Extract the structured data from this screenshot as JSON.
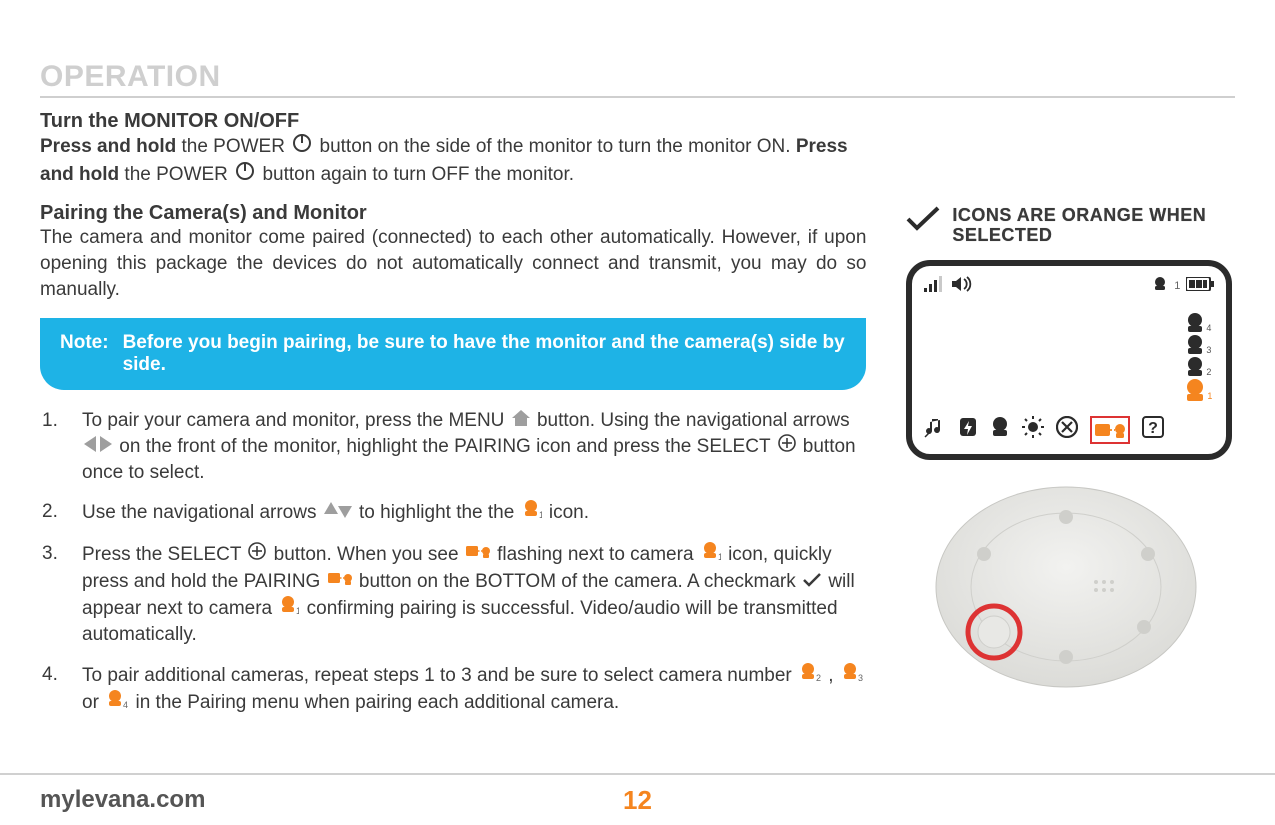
{
  "section_title": "OPERATION",
  "monitor_onoff": {
    "heading": "Turn the MONITOR ON/OFF",
    "part1a": "Press and hold",
    "part1b": " the POWER ",
    "part1c": " button on the side of the monitor to turn the monitor ON. ",
    "part2a": "Press and hold",
    "part2b": " the POWER ",
    "part2c": " button again to turn OFF the monitor."
  },
  "pairing": {
    "heading": "Pairing the Camera(s) and Monitor",
    "body": "The camera and monitor come paired (connected) to each other automatically. However, if upon opening this package the devices do not automatically connect and transmit, you may do so manually."
  },
  "note": {
    "label": "Note:",
    "body": "Before you begin pairing, be sure to have the monitor and the camera(s) side by side."
  },
  "steps": {
    "s1a": "To pair your camera and monitor, press the MENU ",
    "s1b": " button.  Using the navigational arrows ",
    "s1c": " on the front of the monitor, highlight the PAIRING icon and press the SELECT ",
    "s1d": " button once to select.",
    "s2a": "Use the navigational arrows ",
    "s2b": "to highlight the the ",
    "s2c": " icon.",
    "s3a": "Press the SELECT ",
    "s3b": " button.  When you see ",
    "s3c": " flashing next to camera ",
    "s3d": " icon, quickly press and hold the PAIRING ",
    "s3e": " button on the BOTTOM of the camera. A checkmark ",
    "s3f": " will appear next to camera  ",
    "s3g": " confirming pairing is successful. Video/audio will be transmitted automatically.",
    "s4a": "To pair additional cameras, repeat steps 1 to 3 and be sure to select camera number ",
    "s4b": " , ",
    "s4c": " or ",
    "s4d": " in the Pairing menu when pairing each additional camera."
  },
  "callout": "ICONS ARE ORANGE WHEN SELECTED",
  "cam_labels": {
    "c1": "1",
    "c2": "2",
    "c3": "3",
    "c4": "4"
  },
  "footer": {
    "url": "mylevana.com",
    "page": "12"
  }
}
